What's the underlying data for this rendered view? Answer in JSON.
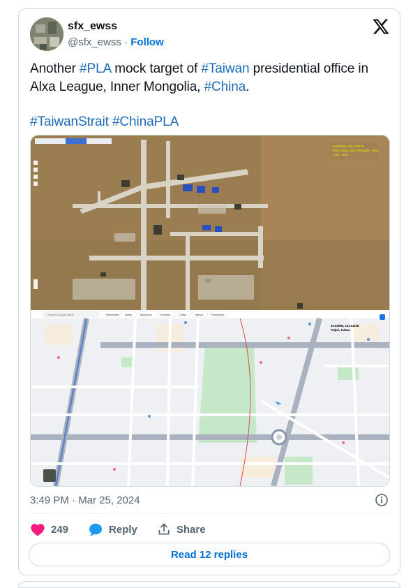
{
  "author": {
    "name": "sfx_ewss",
    "handle": "@sfx_ewss",
    "separator": "·",
    "follow_label": "Follow"
  },
  "tweet": {
    "line1_prefix": "Another ",
    "tag_pla": "#PLA",
    "line1_mid": " mock target of ",
    "tag_taiwan": "#Taiwan",
    "line1_suffix": " presidential office in Alxa League, Inner Mongolia, ",
    "tag_china": "#China",
    "line1_end": ".",
    "tag_strait": "#TaiwanStrait",
    "tag_chinapla": "#ChinaPLA"
  },
  "media": {
    "top_overlay": "39.25823N, 105.42037E\nAlxa League, Inner Mongolia, China\n1:100 , 2024",
    "bottom_overlay": "25.0399N, 121.5120E\nTaipei, Taiwan",
    "map_search_placeholder": "Search Google Maps",
    "map_chips": [
      "Restaurants",
      "Hotels",
      "Attractions",
      "Groceries",
      "Coffee",
      "Takeout",
      "Pharmacies"
    ]
  },
  "timestamp": "3:49 PM · Mar 25, 2024",
  "engagement": {
    "likes": "249",
    "reply_label": "Reply",
    "share_label": "Share"
  },
  "read_replies_label": "Read 12 replies",
  "colors": {
    "like": "#f91880",
    "link": "#006fd6",
    "hashtag": "#1d6bb8",
    "muted": "#536471",
    "border": "#cfd9de"
  },
  "icons": [
    "x-logo-icon",
    "info-icon",
    "heart-icon",
    "reply-bubble-icon",
    "share-upload-icon"
  ]
}
